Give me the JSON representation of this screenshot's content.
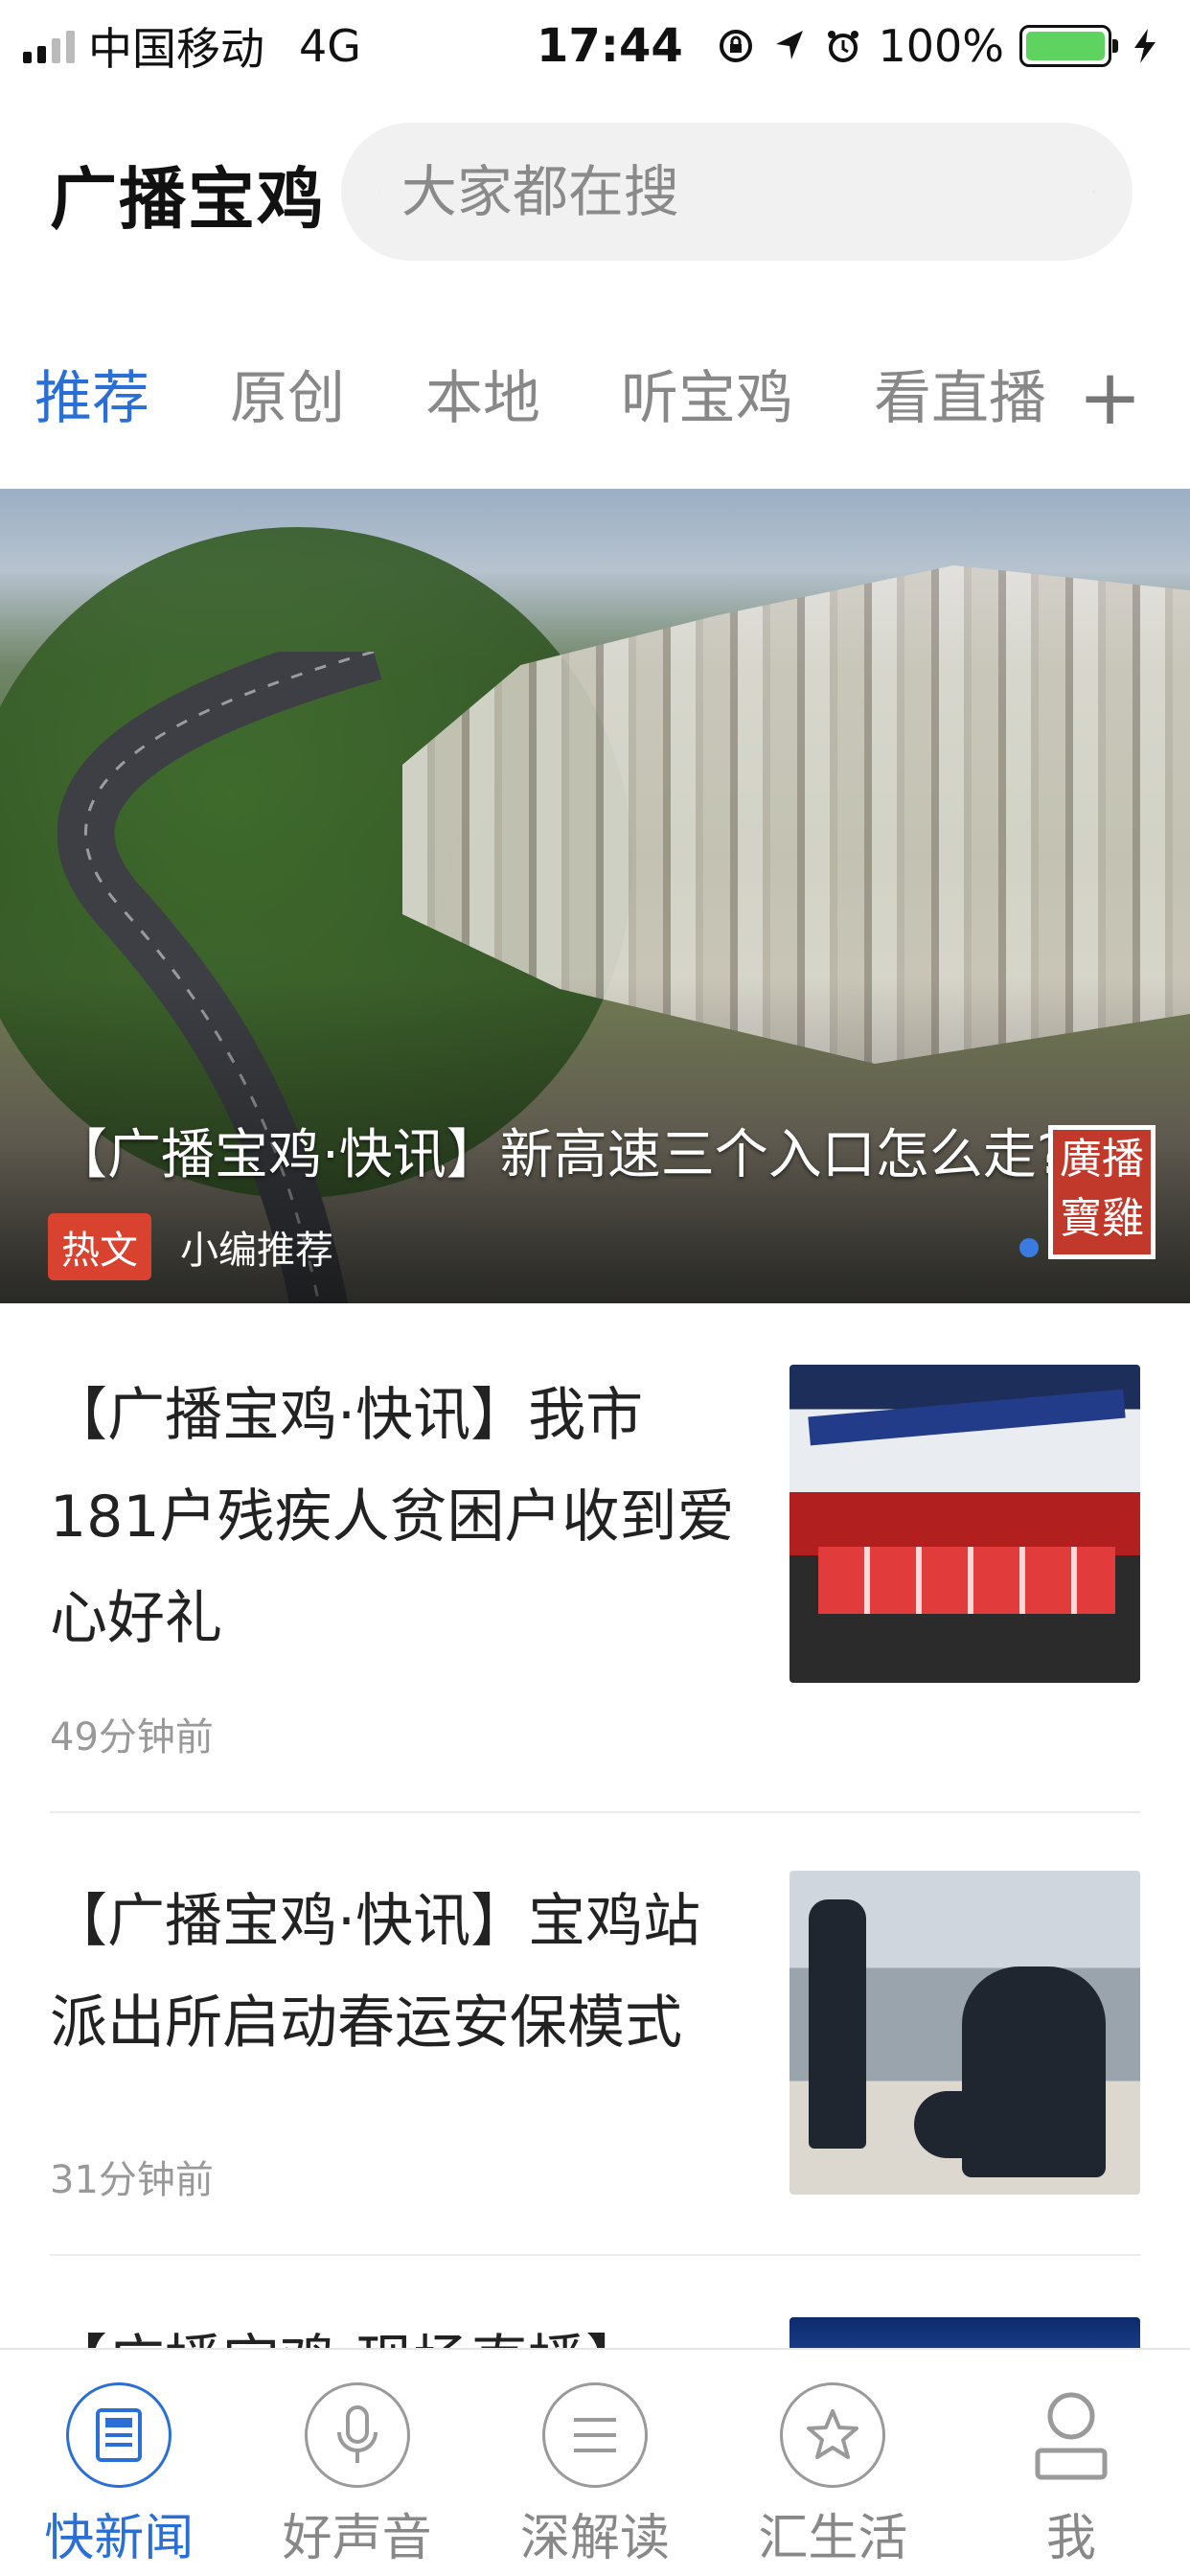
{
  "status_bar": {
    "carrier": "中国移动",
    "network": "4G",
    "time": "17:44",
    "battery": "100%"
  },
  "header": {
    "app_title": "广播宝鸡",
    "search_placeholder": "大家都在搜"
  },
  "tabs": [
    {
      "label": "推荐",
      "active": true
    },
    {
      "label": "原创",
      "active": false
    },
    {
      "label": "本地",
      "active": false
    },
    {
      "label": "听宝鸡",
      "active": false
    },
    {
      "label": "看直播",
      "active": false
    }
  ],
  "tab_add": "+",
  "hero": {
    "title": "【广播宝鸡·快讯】新高速三个入口怎么走?",
    "badge": "热文",
    "recommend": "小编推荐",
    "seal_text": "廣播寶雞"
  },
  "news": [
    {
      "title": "【广播宝鸡·快讯】我市181户残疾人贫困户收到爱心好礼",
      "time": "49分钟前"
    },
    {
      "title": "【广播宝鸡·快讯】宝鸡站派出所启动春运安保模式",
      "time": "31分钟前"
    },
    {
      "title": "【广播宝鸡·现场直播】",
      "time": ""
    }
  ],
  "tabbar": [
    {
      "label": "快新闻",
      "icon": "news-icon",
      "active": true
    },
    {
      "label": "好声音",
      "icon": "microphone-icon",
      "active": false
    },
    {
      "label": "深解读",
      "icon": "list-icon",
      "active": false
    },
    {
      "label": "汇生活",
      "icon": "star-icon",
      "active": false
    },
    {
      "label": "我",
      "icon": "person-icon",
      "active": false
    }
  ],
  "colors": {
    "accent": "#2a6fd6",
    "hot_badge": "#d8422e",
    "battery": "#5fd35f"
  }
}
